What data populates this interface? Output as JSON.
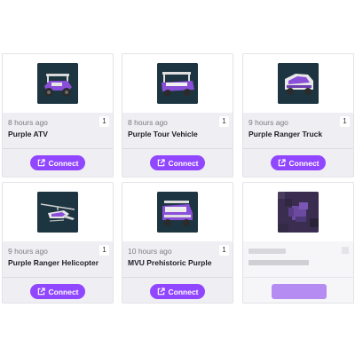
{
  "cards": [
    {
      "time": "8 hours ago",
      "count": "1",
      "name": "Purple ATV",
      "button": "Connect",
      "icon": "atv-vehicle-icon"
    },
    {
      "time": "8 hours ago",
      "count": "1",
      "name": "Purple Tour Vehicle",
      "button": "Connect",
      "icon": "tour-vehicle-icon"
    },
    {
      "time": "9 hours ago",
      "count": "1",
      "name": "Purple Ranger Truck",
      "button": "Connect",
      "icon": "ranger-truck-icon"
    },
    {
      "time": "9 hours ago",
      "count": "1",
      "name": "Purple Ranger Helicopter",
      "button": "Connect",
      "icon": "helicopter-icon"
    },
    {
      "time": "10 hours ago",
      "count": "1",
      "name": "MVU Prehistoric Purple",
      "button": "Connect",
      "icon": "mvu-vehicle-icon"
    }
  ],
  "colors": {
    "accent": "#9146ff",
    "card_bg": "#efeef2",
    "thumb_bg": "#1c3540",
    "vehicle_purple": "#8a4fd8"
  }
}
